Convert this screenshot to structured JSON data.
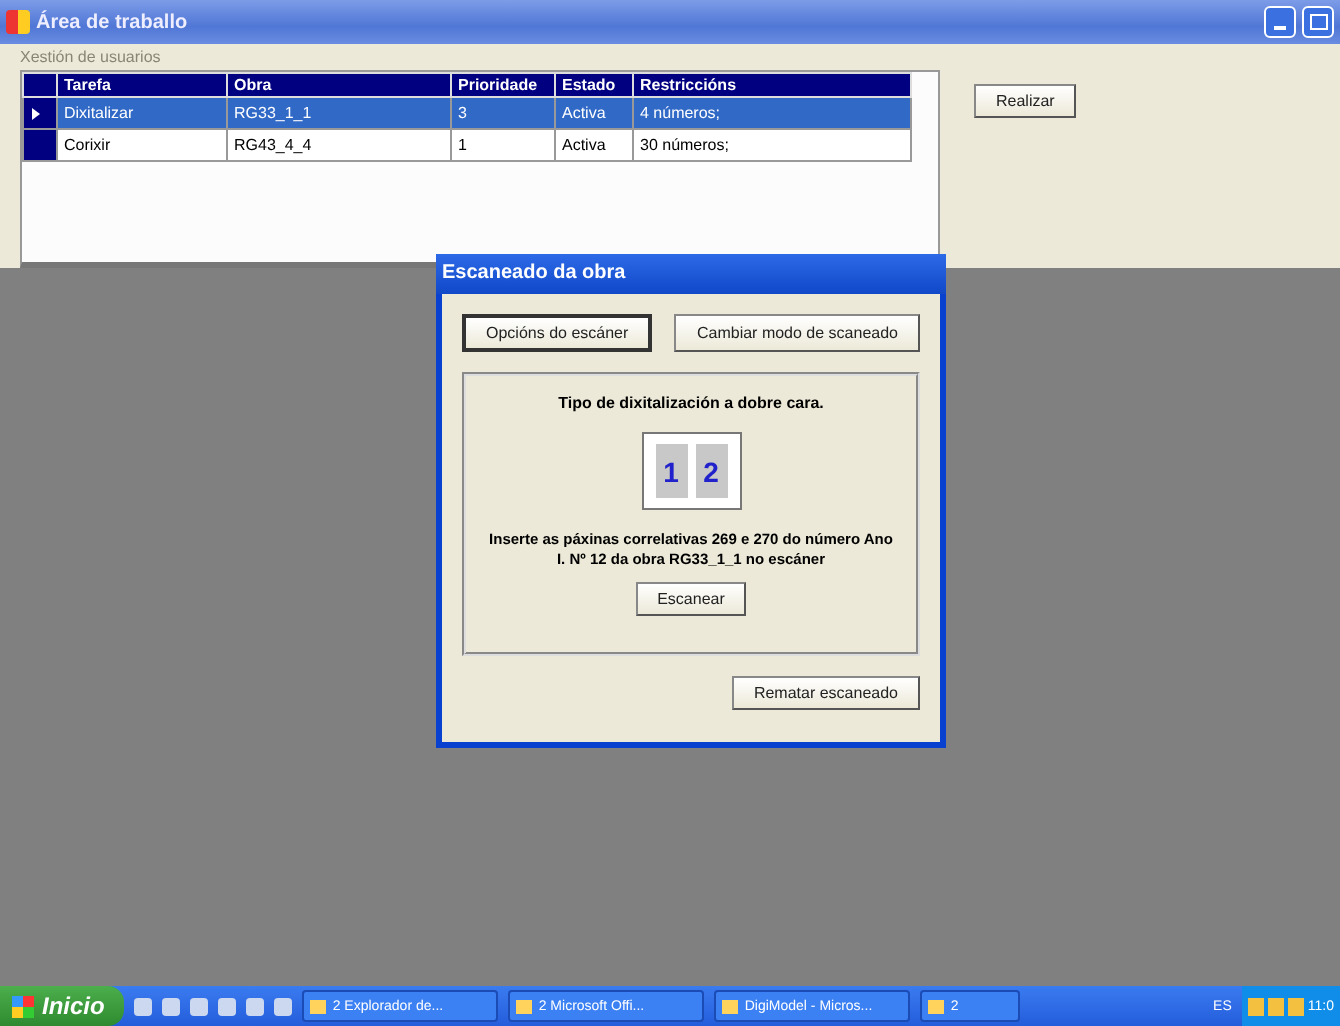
{
  "window": {
    "title": "Área de traballo"
  },
  "menu": [
    "Xestión de usuarios"
  ],
  "table": {
    "columns": [
      "Tarefa",
      "Obra",
      "Prioridade",
      "Estado",
      "Restriccións"
    ],
    "rows": [
      {
        "selected": true,
        "cells": [
          "Dixitalizar",
          "RG33_1_1",
          "3",
          "Activa",
          "4 números;"
        ]
      },
      {
        "selected": false,
        "cells": [
          "Corixir",
          "RG43_4_4",
          "1",
          "Activa",
          "30 números;"
        ]
      }
    ]
  },
  "side_button": "Realizar",
  "dialog": {
    "title": "Escaneado da obra",
    "buttons": [
      {
        "label": "Opcións do escáner",
        "focused": true
      },
      {
        "label": "Cambiar modo de scaneado",
        "focused": false
      }
    ],
    "heading": "Tipo de dixitalización a dobre cara.",
    "page_labels": [
      "1",
      "2"
    ],
    "instruction": "Inserte as páxinas correlativas 269 e 270 do número Ano I. Nº 12 da obra RG33_1_1 no escáner",
    "scan_button": "Escanear",
    "finish_button": "Rematar escaneado"
  },
  "taskbar": {
    "start": "Inicio",
    "tasks": [
      "2 Explorador de...",
      "2 Microsoft Offi...",
      "DigiModel - Micros...",
      "2"
    ],
    "language": "ES",
    "clock": "11:0"
  }
}
